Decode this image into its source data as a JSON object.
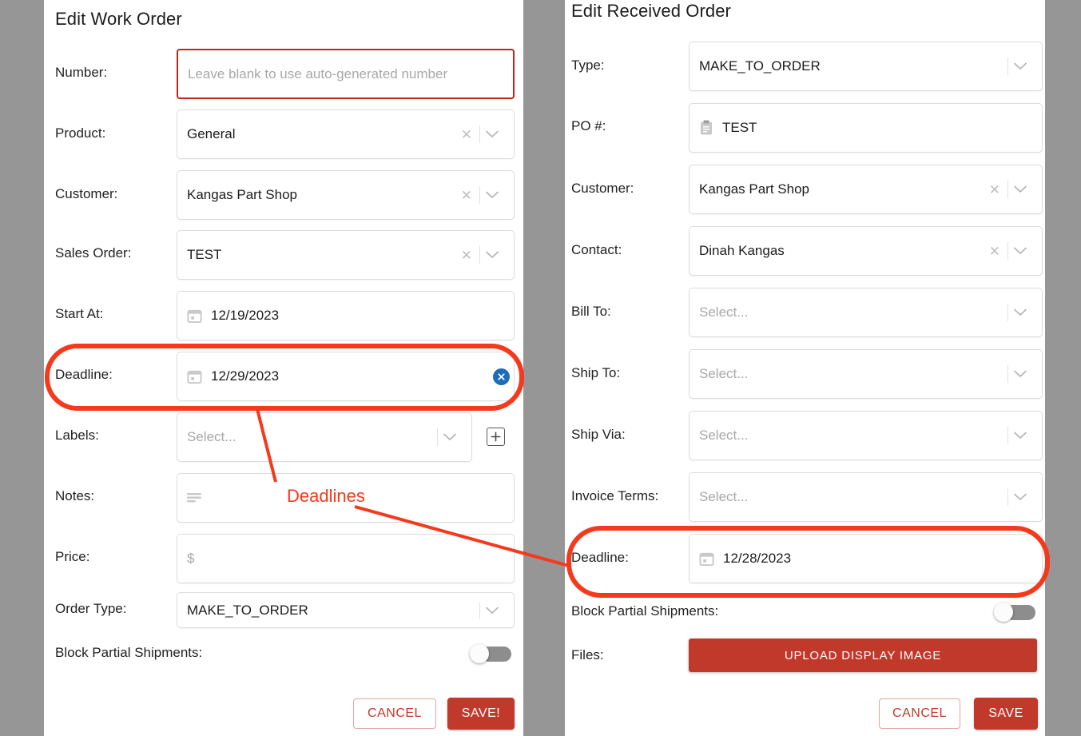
{
  "left_panel": {
    "title": "Edit Work Order",
    "rows": [
      {
        "label": "Number:",
        "value": "Leave blank to use auto-generated number",
        "placeholder": true,
        "icon": "none"
      },
      {
        "label": "Product:",
        "value": "General",
        "placeholder": false,
        "icon": "none"
      },
      {
        "label": "Customer:",
        "value": "Kangas Part Shop",
        "placeholder": false,
        "icon": "none"
      },
      {
        "label": "Sales Order:",
        "value": "TEST",
        "placeholder": false,
        "icon": "none"
      },
      {
        "label": "Start At:",
        "value": "12/19/2023",
        "placeholder": false,
        "icon": "calendar-icon"
      },
      {
        "label": "Deadline:",
        "value": "12/29/2023",
        "placeholder": false,
        "icon": "calendar-icon"
      },
      {
        "label": "Labels:",
        "value": "Select...",
        "placeholder": true,
        "icon": "none"
      },
      {
        "label": "Notes:",
        "value": "",
        "placeholder": true,
        "icon": "notes-icon"
      },
      {
        "label": "Price:",
        "value": "$",
        "placeholder": true,
        "icon": "none"
      },
      {
        "label": "Order Type:",
        "value": "MAKE_TO_ORDER",
        "placeholder": false,
        "icon": "none"
      },
      {
        "label": "Block Partial Shipments:",
        "value": "",
        "placeholder": false,
        "icon": "none"
      }
    ],
    "cancel_label": "CANCEL",
    "save_label": "SAVE!"
  },
  "right_panel": {
    "title": "Edit Received Order",
    "rows": [
      {
        "label": "Type:",
        "value": "MAKE_TO_ORDER",
        "placeholder": false,
        "icon": "none"
      },
      {
        "label": "PO #:",
        "value": "TEST",
        "placeholder": false,
        "icon": "clipboard-icon"
      },
      {
        "label": "Customer:",
        "value": "Kangas Part Shop",
        "placeholder": false,
        "icon": "none"
      },
      {
        "label": "Contact:",
        "value": "Dinah Kangas",
        "placeholder": false,
        "icon": "none"
      },
      {
        "label": "Bill To:",
        "value": "Select...",
        "placeholder": true,
        "icon": "none"
      },
      {
        "label": "Ship To:",
        "value": "Select...",
        "placeholder": true,
        "icon": "none"
      },
      {
        "label": "Ship Via:",
        "value": "Select...",
        "placeholder": true,
        "icon": "none"
      },
      {
        "label": "Invoice Terms:",
        "value": "Select...",
        "placeholder": true,
        "icon": "none"
      },
      {
        "label": "Deadline:",
        "value": "12/28/2023",
        "placeholder": false,
        "icon": "calendar-icon"
      },
      {
        "label": "Block Partial Shipments:",
        "value": "",
        "placeholder": false,
        "icon": "none"
      },
      {
        "label": "Files:",
        "value": "",
        "placeholder": false,
        "icon": "none"
      }
    ],
    "upload_label": "UPLOAD DISPLAY IMAGE",
    "cancel_label": "CANCEL",
    "save_label": "SAVE"
  },
  "annotation": {
    "text": "Deadlines",
    "color": "#f4391c"
  },
  "colors": {
    "page_background": "#969696",
    "panel_background": "#ffffff",
    "accent_red": "#c0392b",
    "annotation_red": "#f4391c",
    "error_border": "#c0261c",
    "clear_button_blue": "#1d6cb9",
    "toggle_track_off": "#8d8d8d"
  }
}
